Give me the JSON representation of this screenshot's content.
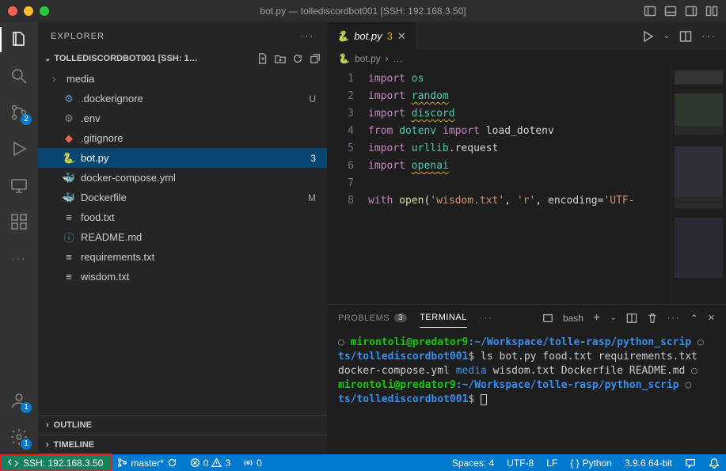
{
  "window": {
    "title": "bot.py — tollediscordbot001 [SSH: 192.168.3.50]"
  },
  "activitybar": {
    "scm_badge": "2",
    "accounts_badge": "1",
    "settings_badge": "1"
  },
  "sidebar": {
    "title": "EXPLORER",
    "project_label": "TOLLEDISCORDBOT001 [SSH: 1…",
    "items": [
      {
        "name": "media",
        "kind": "folder",
        "chev": "›",
        "tail": ""
      },
      {
        "name": ".dockerignore",
        "kind": "file",
        "icon": "⚙",
        "tail": "U"
      },
      {
        "name": ".env",
        "kind": "file",
        "icon": "⚙",
        "tail": ""
      },
      {
        "name": ".gitignore",
        "kind": "file",
        "icon": "◆",
        "tail": ""
      },
      {
        "name": "bot.py",
        "kind": "file",
        "icon": "🐍",
        "tail": "3",
        "selected": true
      },
      {
        "name": "docker-compose.yml",
        "kind": "file",
        "icon": "🐳",
        "tail": ""
      },
      {
        "name": "Dockerfile",
        "kind": "file",
        "icon": "🐳",
        "tail": "M"
      },
      {
        "name": "food.txt",
        "kind": "file",
        "icon": "≡",
        "tail": ""
      },
      {
        "name": "README.md",
        "kind": "file",
        "icon": "ⓘ",
        "tail": ""
      },
      {
        "name": "requirements.txt",
        "kind": "file",
        "icon": "≡",
        "tail": ""
      },
      {
        "name": "wisdom.txt",
        "kind": "file",
        "icon": "≡",
        "tail": ""
      }
    ],
    "outline": "OUTLINE",
    "timeline": "TIMELINE"
  },
  "tabs": {
    "active": {
      "icon": "🐍",
      "label": "bot.py",
      "count": "3"
    }
  },
  "breadcrumb": {
    "icon": "🐍",
    "file": "bot.py",
    "sep": "›",
    "more": "…"
  },
  "editor": {
    "lines": [
      "1",
      "2",
      "3",
      "4",
      "5",
      "6",
      "7",
      "8"
    ]
  },
  "code": {
    "l1a": "import",
    "l1b": "os",
    "l2a": "import",
    "l2b": "random",
    "l3a": "import",
    "l3b": "discord",
    "l4a": "from",
    "l4b": "dotenv",
    "l4c": "import",
    "l4d": "load_dotenv",
    "l5a": "import",
    "l5b": "urllib",
    "l5c": ".request",
    "l6a": "import",
    "l6b": "openai",
    "l8a": "with",
    "l8b": "open",
    "l8c": "(",
    "l8d": "'wisdom.txt'",
    "l8e": ", ",
    "l8f": "'r'",
    "l8g": ", encoding=",
    "l8h": "'UTF-"
  },
  "panel": {
    "tabs": {
      "problems": "PROBLEMS",
      "problems_count": "3",
      "terminal": "TERMINAL",
      "more": "···",
      "shell": "bash"
    }
  },
  "terminal": {
    "user": "mirontoli",
    "at": "@",
    "host": "predator9",
    "colon": ":",
    "path": "~/Workspace/tolle-rasp/python_scrip",
    "path2": "ts/tollediscordbot001",
    "prompt": "$",
    "cmd1": "ls",
    "ls_row1": "bot.py              food.txt   requirements.txt",
    "ls_row2a": "docker-compose.yml  ",
    "ls_row2b": "media",
    "ls_row2c": "      wisdom.txt",
    "ls_row3": "Dockerfile          README.md"
  },
  "statusbar": {
    "remote": "SSH: 192.168.3.50",
    "branch": "master*",
    "errors": "0",
    "warnings": "3",
    "ports": "0",
    "spaces": "Spaces: 4",
    "encoding": "UTF-8",
    "eol": "LF",
    "lang": "Python",
    "version": "3.9.6 64-bit"
  }
}
